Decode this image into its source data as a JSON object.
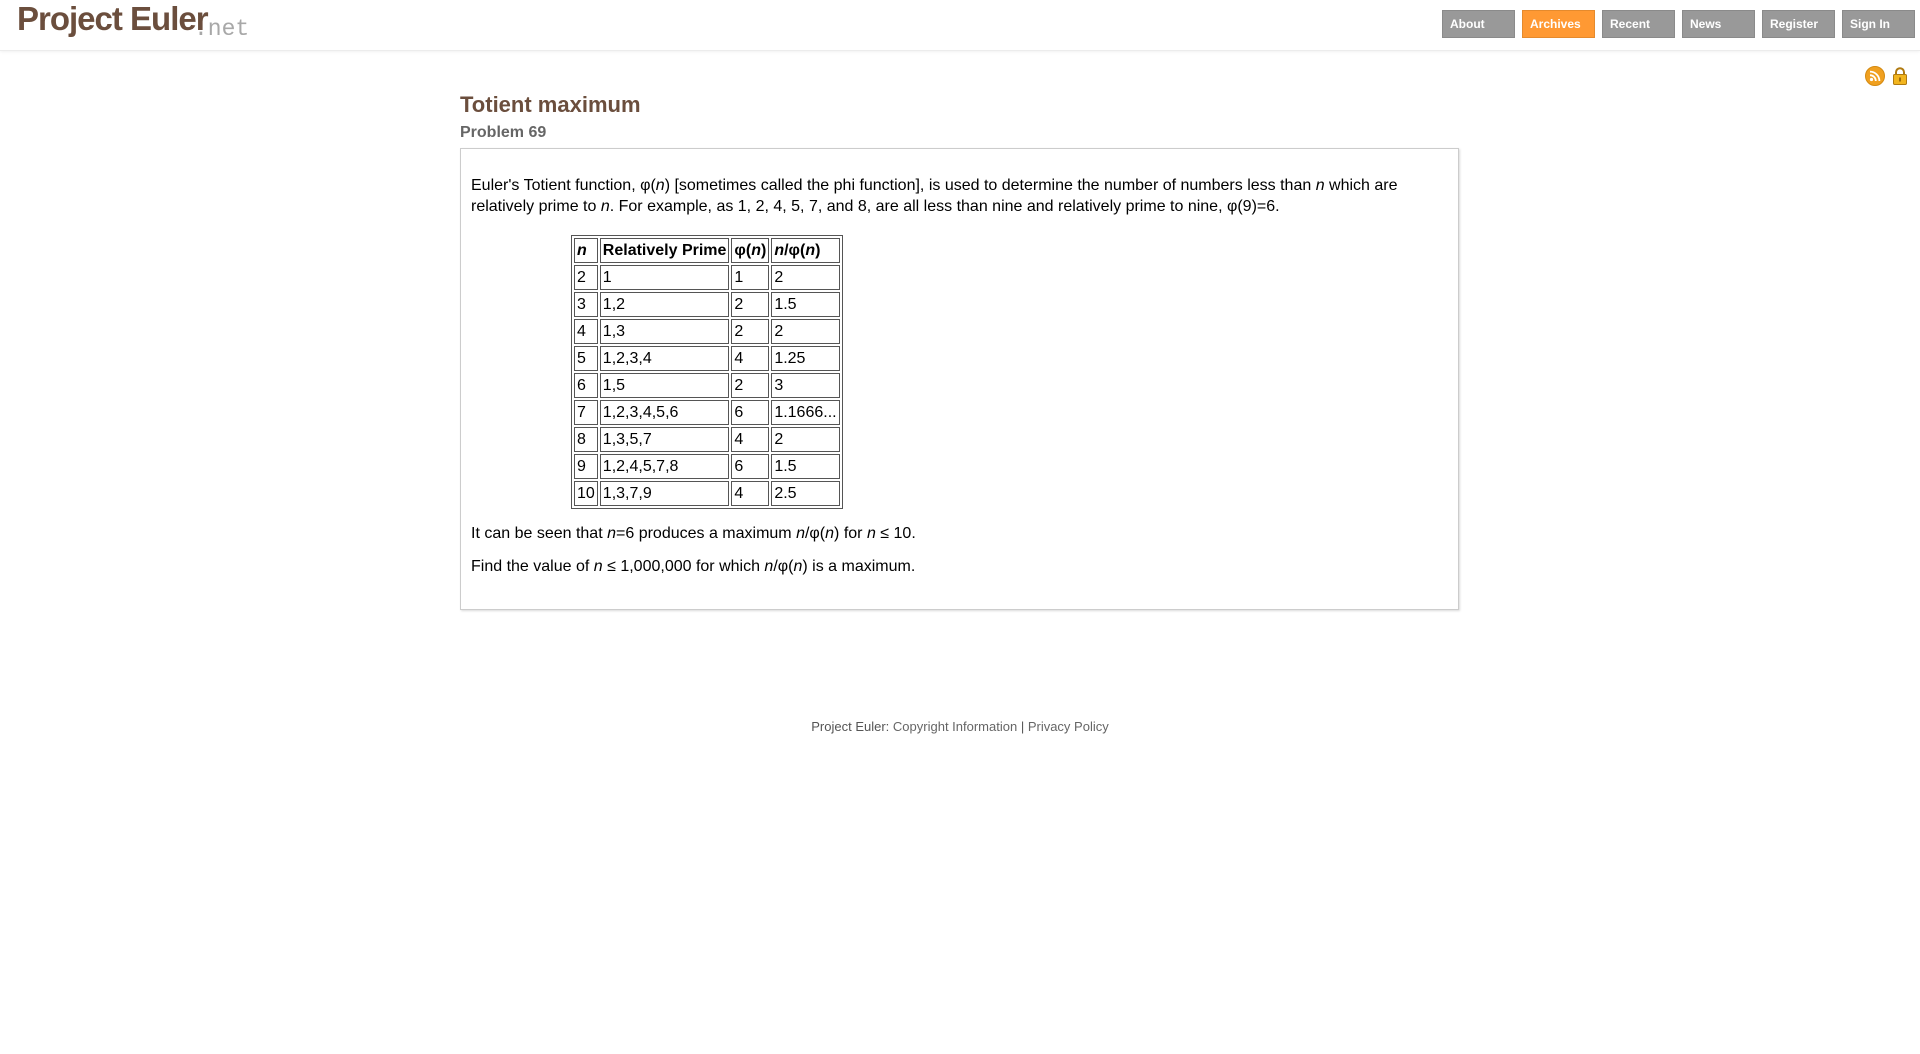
{
  "header": {
    "logo_main": "Project Euler",
    "logo_suffix": ".net",
    "nav": [
      {
        "label": "About"
      },
      {
        "label": "Archives",
        "active": true
      },
      {
        "label": "Recent"
      },
      {
        "label": "News"
      },
      {
        "label": "Register"
      },
      {
        "label": "Sign In"
      }
    ]
  },
  "icons": [
    "rss-icon",
    "lock-icon"
  ],
  "colors": {
    "accent": "#ff9933",
    "nav_bg": "#999999",
    "title": "#6b4e3d"
  },
  "problem": {
    "title": "Totient maximum",
    "number": "Problem 69",
    "intro": {
      "t1": "Euler's Totient function, φ(",
      "n1": "n",
      "t2": ") [sometimes called the phi function], is used to determine the number of numbers less than ",
      "n2": "n",
      "t3": " which are relatively prime to ",
      "n3": "n",
      "t4": ". For example, as 1, 2, 4, 5, 7, and 8, are all less than nine and relatively prime to nine, φ(9)=6."
    },
    "table": {
      "headers": {
        "n": "n",
        "rel": "Relatively Prime",
        "phi_a": "φ(",
        "phi_n": "n",
        "phi_b": ")",
        "ratio_n": "n",
        "ratio_a": "/φ(",
        "ratio_n2": "n",
        "ratio_b": ")"
      },
      "rows": [
        {
          "n": "2",
          "rel": "1",
          "phi": "1",
          "ratio": "2"
        },
        {
          "n": "3",
          "rel": "1,2",
          "phi": "2",
          "ratio": "1.5"
        },
        {
          "n": "4",
          "rel": "1,3",
          "phi": "2",
          "ratio": "2"
        },
        {
          "n": "5",
          "rel": "1,2,3,4",
          "phi": "4",
          "ratio": "1.25"
        },
        {
          "n": "6",
          "rel": "1,5",
          "phi": "2",
          "ratio": "3"
        },
        {
          "n": "7",
          "rel": "1,2,3,4,5,6",
          "phi": "6",
          "ratio": "1.1666..."
        },
        {
          "n": "8",
          "rel": "1,3,5,7",
          "phi": "4",
          "ratio": "2"
        },
        {
          "n": "9",
          "rel": "1,2,4,5,7,8",
          "phi": "6",
          "ratio": "1.5"
        },
        {
          "n": "10",
          "rel": "1,3,7,9",
          "phi": "4",
          "ratio": "2.5"
        }
      ]
    },
    "p2": {
      "t1": "It can be seen that ",
      "n1": "n",
      "t2": "=6 produces a maximum ",
      "n2": "n",
      "t3": "/φ(",
      "n3": "n",
      "t4": ") for ",
      "n4": "n",
      "t5": " ≤ 10."
    },
    "p3": {
      "t1": "Find the value of ",
      "n1": "n",
      "t2": " ≤ 1,000,000 for which ",
      "n2": "n",
      "t3": "/φ(",
      "n3": "n",
      "t4": ") is a maximum."
    }
  },
  "footer": {
    "prefix": "Project Euler: ",
    "copyright": "Copyright Information",
    "sep": " | ",
    "privacy": "Privacy Policy"
  }
}
